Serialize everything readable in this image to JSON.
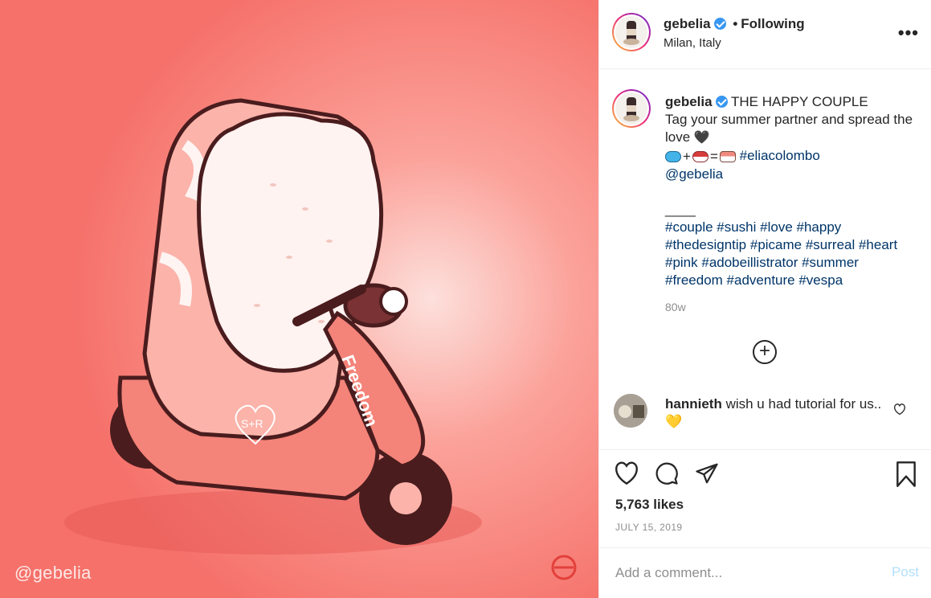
{
  "post_image": {
    "watermark": "@gebelia",
    "scooter_text": "Freedom",
    "heart_text": "S+R",
    "colors": {
      "background": "#f5716a",
      "salmon": "#fbb3aa",
      "rice": "#fff3f1",
      "dark": "#4a1c1e"
    }
  },
  "header": {
    "username": "gebelia",
    "separator": "•",
    "follow_status": "Following",
    "location": "Milan, Italy",
    "more_icon": "ellipsis-icon"
  },
  "caption": {
    "username": "gebelia",
    "line1": "THE HAPPY COUPLE",
    "line2": "Tag your summer partner and spread the love",
    "emoji_plus": "+",
    "emoji_equals": "=",
    "tag_eliacolombo": "#eliacolombo",
    "mention": "@gebelia",
    "divider": "____",
    "hashtags": "#couple #sushi #love #happy #thedesigntip #picame #surreal #heart #pink #adobeillistrator #summer #freedom #adventure #vespa",
    "time_ago": "80w"
  },
  "comment": {
    "username": "hannieth",
    "text": "wish u had tutorial for us.."
  },
  "actions": {
    "likes": "5,763 likes",
    "date": "JULY 15, 2019"
  },
  "add_comment": {
    "placeholder": "Add a comment...",
    "post_label": "Post"
  }
}
